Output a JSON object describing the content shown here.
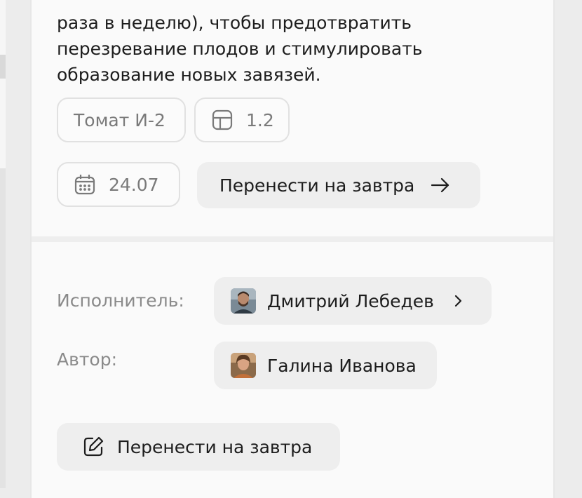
{
  "description_lines": [
    "раза в неделю), чтобы предотвратить",
    "перезревание плодов и стимулировать",
    "образование новых завязей."
  ],
  "tags": {
    "variety": "Томат И-2",
    "plot": "1.2",
    "date": "24.07"
  },
  "actions": {
    "reschedule_top": "Перенести на завтра",
    "reschedule_bottom": "Перенести на завтра"
  },
  "assignee": {
    "label": "Исполнитель:",
    "name": "Дмитрий Лебедев"
  },
  "author": {
    "label": "Автор:",
    "name": "Галина Иванова"
  },
  "icons": {
    "plot": "grid-icon",
    "date": "calendar-icon",
    "arrow": "arrow-right-icon",
    "chevron": "chevron-right-icon",
    "edit": "edit-icon"
  },
  "colors": {
    "card_bg": "#fafafa",
    "button_bg": "#eeeeee",
    "chip_border": "#e1e1e1",
    "muted_text": "#8a8a8a",
    "text": "#1d1d1d"
  }
}
